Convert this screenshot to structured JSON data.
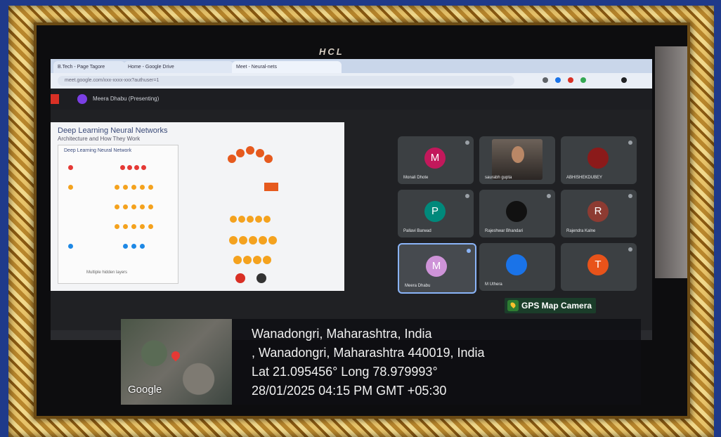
{
  "laptop": {
    "brand": "HCL"
  },
  "browser": {
    "tabs": [
      {
        "label": "B.Tech - Page Tagore",
        "active": false
      },
      {
        "label": "Home - Google Drive",
        "active": false
      },
      {
        "label": "Meet - Neural-nets",
        "active": true
      }
    ],
    "url": "meet.google.com/xxx-xxxx-xxx?authuser=1"
  },
  "meet": {
    "presenter_label": "Meera Dhabu (Presenting)",
    "slide": {
      "title": "Deep Learning Neural Networks",
      "subtitle": "Architecture and How They Work",
      "diagram_title": "Deep Learning Neural Network",
      "footer": "Multiple hidden layers"
    },
    "participants": [
      {
        "name": "Monali Dhote",
        "initial": "M",
        "color": "#c2185b"
      },
      {
        "name": "saurabh gupta",
        "initial": "",
        "color": "#000000"
      },
      {
        "name": "ABHISHEKDUBEY",
        "initial": "",
        "color": "#8b1a1a"
      },
      {
        "name": "Pallavi Barwad",
        "initial": "P",
        "color": "#00897b"
      },
      {
        "name": "Rajeshwar Bhandari",
        "initial": "",
        "color": "#000000"
      },
      {
        "name": "Rajendra Kalne",
        "initial": "R",
        "color": "#8d3b32"
      },
      {
        "name": "Meera Dhabu",
        "initial": "M",
        "color": "#ce93d8"
      },
      {
        "name": "M Uthera",
        "initial": "",
        "color": "#1a73e8"
      },
      {
        "name": "T",
        "initial": "T",
        "color": "#e8531a"
      }
    ]
  },
  "gps": {
    "app_name": "GPS Map Camera",
    "map_provider": "Google",
    "place": "Wanadongri, Maharashtra, India",
    "address": ", Wanadongri, Maharashtra 440019, India",
    "coords": "Lat 21.095456° Long 78.979993°",
    "datetime": "28/01/2025 04:15 PM GMT +05:30"
  }
}
